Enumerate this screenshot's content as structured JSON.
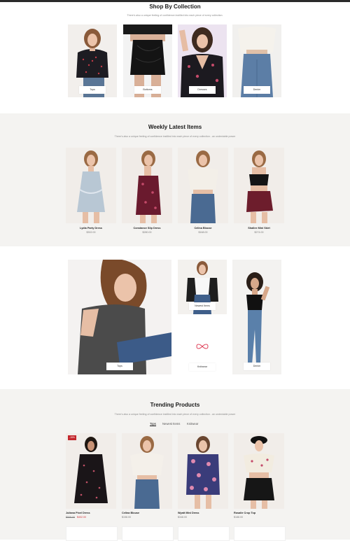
{
  "colors": {
    "accent": "#1a1a1a",
    "sale": "#d0333a",
    "band": "#f4f3f1"
  },
  "collection": {
    "title": "Shop By Collection",
    "subtitle": "There's also a unique feeling of confidence instilled into each piece of every collection.",
    "items": [
      {
        "label": "Tops"
      },
      {
        "label": "Bottoms"
      },
      {
        "label": "Dresses"
      },
      {
        "label": "Denim"
      }
    ]
  },
  "weekly": {
    "title": "Weekly Latest Items",
    "subtitle": "There's also a unique feeling of confidence instilled into each piece of every collection - an undeniable power",
    "products": [
      {
        "name": "Lydia Party Dress",
        "price": "$302.00"
      },
      {
        "name": "Constance Slip Dress",
        "price": "$280.00"
      },
      {
        "name": "Celina Blouse",
        "price": "$168.00"
      },
      {
        "name": "Shallee Mini Skirt",
        "price": "$274.00"
      }
    ]
  },
  "banner": {
    "tops_label": "Tops",
    "newest_label": "Newest Items",
    "knitwear_label": "Knitwear",
    "denim_label": "Denim"
  },
  "trending": {
    "title": "Trending Products",
    "subtitle": "There's also a unique feeling of confidence instilled into each piece of every collection - an undeniable power",
    "tabs": [
      "Tops",
      "Newest Items",
      "Knitwear"
    ],
    "products": [
      {
        "name": "Juliana Pixel Dress",
        "old_price": "$508.00",
        "price": "$402.00",
        "badge": "-15%"
      },
      {
        "name": "Celina Blouse",
        "price": "$158.00"
      },
      {
        "name": "Wyatt Mini Dress",
        "price": "$348.00"
      },
      {
        "name": "Rosalie Crop Top",
        "price": "$188.00"
      }
    ]
  }
}
